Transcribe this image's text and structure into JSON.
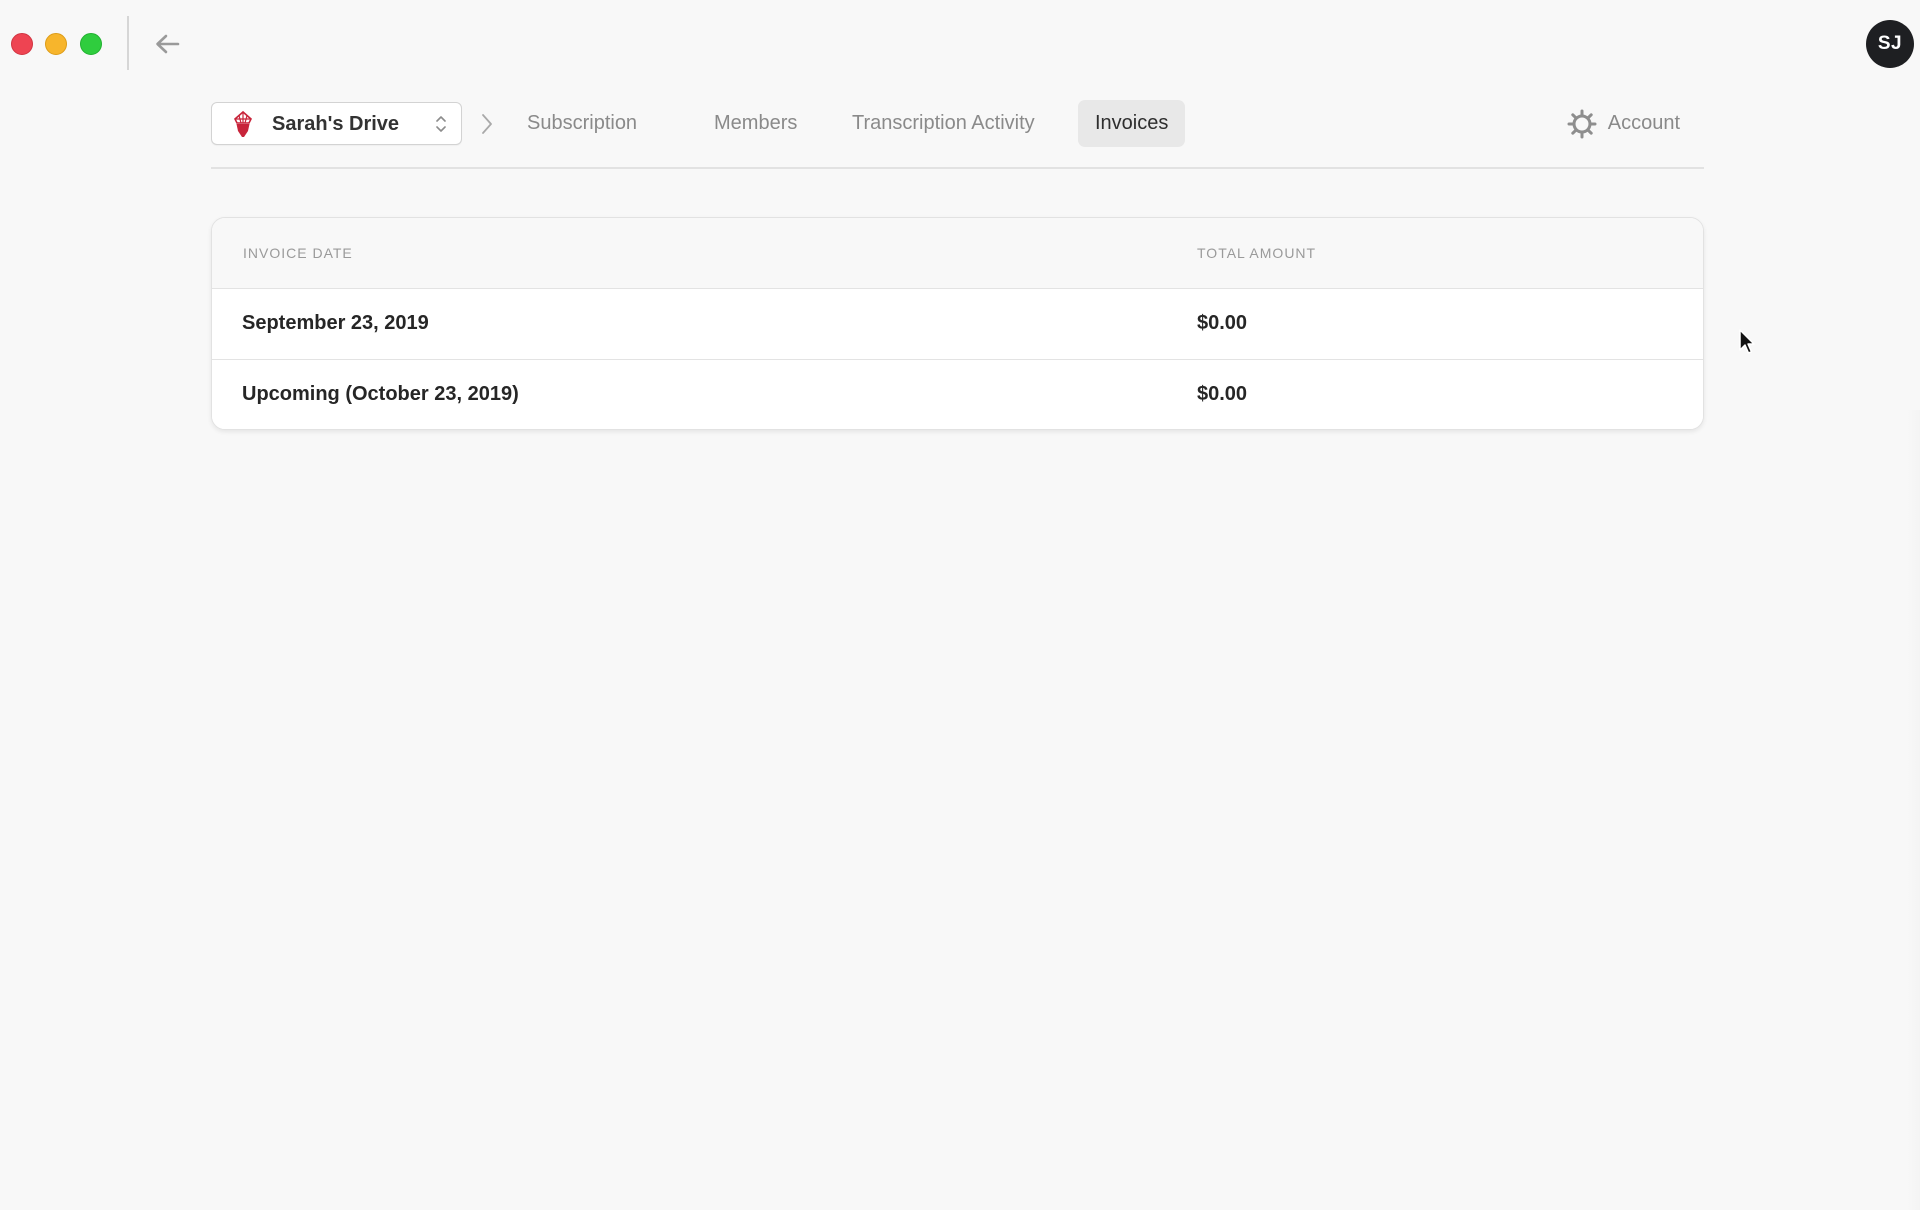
{
  "window": {
    "controls": [
      "close",
      "minimize",
      "maximize"
    ],
    "back_icon": "arrow-left-icon"
  },
  "user": {
    "initials": "SJ"
  },
  "nav": {
    "drive_selector": {
      "label": "Sarah's Drive",
      "logo_icon": "drive-logo-icon",
      "toggle_icon": "chevron-updown-icon",
      "logo_color": "#c8243a"
    },
    "breadcrumb_separator_icon": "chevron-right-icon",
    "tabs": [
      {
        "label": "Subscription",
        "active": false
      },
      {
        "label": "Members",
        "active": false
      },
      {
        "label": "Transcription Activity",
        "active": false
      },
      {
        "label": "Invoices",
        "active": true
      }
    ],
    "account": {
      "label": "Account",
      "icon": "gear-icon"
    }
  },
  "invoices": {
    "columns": [
      "INVOICE DATE",
      "TOTAL AMOUNT"
    ],
    "rows": [
      {
        "date": "September 23, 2019",
        "amount": "$0.00"
      },
      {
        "date": "Upcoming (October 23, 2019)",
        "amount": "$0.00"
      }
    ]
  }
}
